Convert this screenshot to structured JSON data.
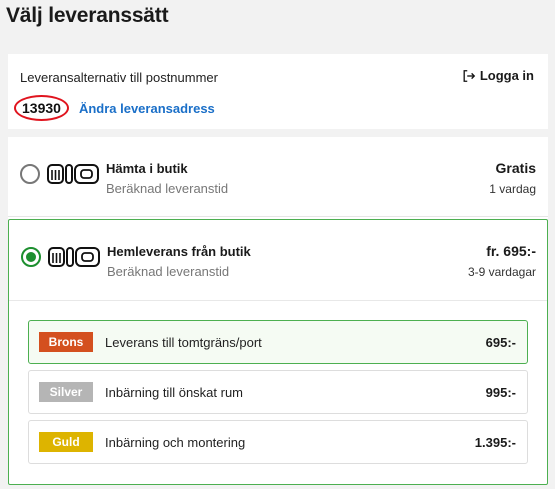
{
  "page": {
    "title": "Välj leveranssätt"
  },
  "postcode": {
    "label": "Leveransalternativ till postnummer",
    "value": "13930",
    "change_link": "Ändra leveransadress",
    "login_label": "Logga in"
  },
  "options": [
    {
      "title": "Hämta i butik",
      "subtitle": "Beräknad leveranstid",
      "price": "Gratis",
      "time": "1 vardag",
      "selected": false
    },
    {
      "title": "Hemleverans från butik",
      "subtitle": "Beräknad leveranstid",
      "price": "fr. 695:-",
      "time": "3-9 vardagar",
      "selected": true
    }
  ],
  "sub_options": [
    {
      "badge": "Brons",
      "badge_color": "#d4501f",
      "label": "Leverans till tomtgräns/port",
      "price": "695:-",
      "selected": true
    },
    {
      "badge": "Silver",
      "badge_color": "#b5b5b5",
      "label": "Inbärning till önskat rum",
      "price": "995:-",
      "selected": false
    },
    {
      "badge": "Guld",
      "badge_color": "#ddb400",
      "label": "Inbärning och montering",
      "price": "1.395:-",
      "selected": false
    }
  ],
  "colors": {
    "accent_green": "#1d8f2f",
    "link_blue": "#1a6fc8",
    "highlight_red": "#e0141e"
  },
  "icons": {
    "login": "logout-arrow-icon",
    "brand": "mio-logo"
  }
}
